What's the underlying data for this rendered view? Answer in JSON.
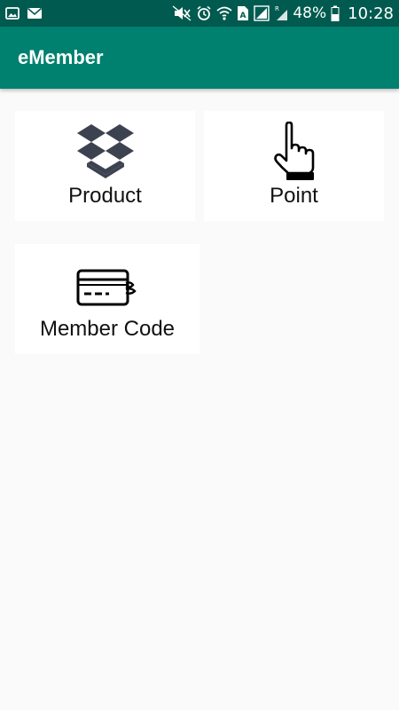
{
  "status_bar": {
    "battery_percent": "48%",
    "time": "10:28",
    "sim_label": "R",
    "icons": [
      "gallery-icon",
      "mail-icon",
      "mute-icon",
      "alarm-icon",
      "wifi-icon",
      "sim-icon",
      "signal-icon",
      "battery-icon"
    ]
  },
  "app_bar": {
    "title": "eMember"
  },
  "menu": {
    "items": [
      {
        "label": "Product",
        "icon": "box-icon"
      },
      {
        "label": "Point",
        "icon": "pointing-hand-icon"
      },
      {
        "label": "Member Code",
        "icon": "credit-card-icon"
      }
    ]
  },
  "colors": {
    "status_bar": "#005a4f",
    "app_bar": "#00806f",
    "background": "#fafafa",
    "tile": "#ffffff",
    "icon_dark": "#3d4250"
  }
}
